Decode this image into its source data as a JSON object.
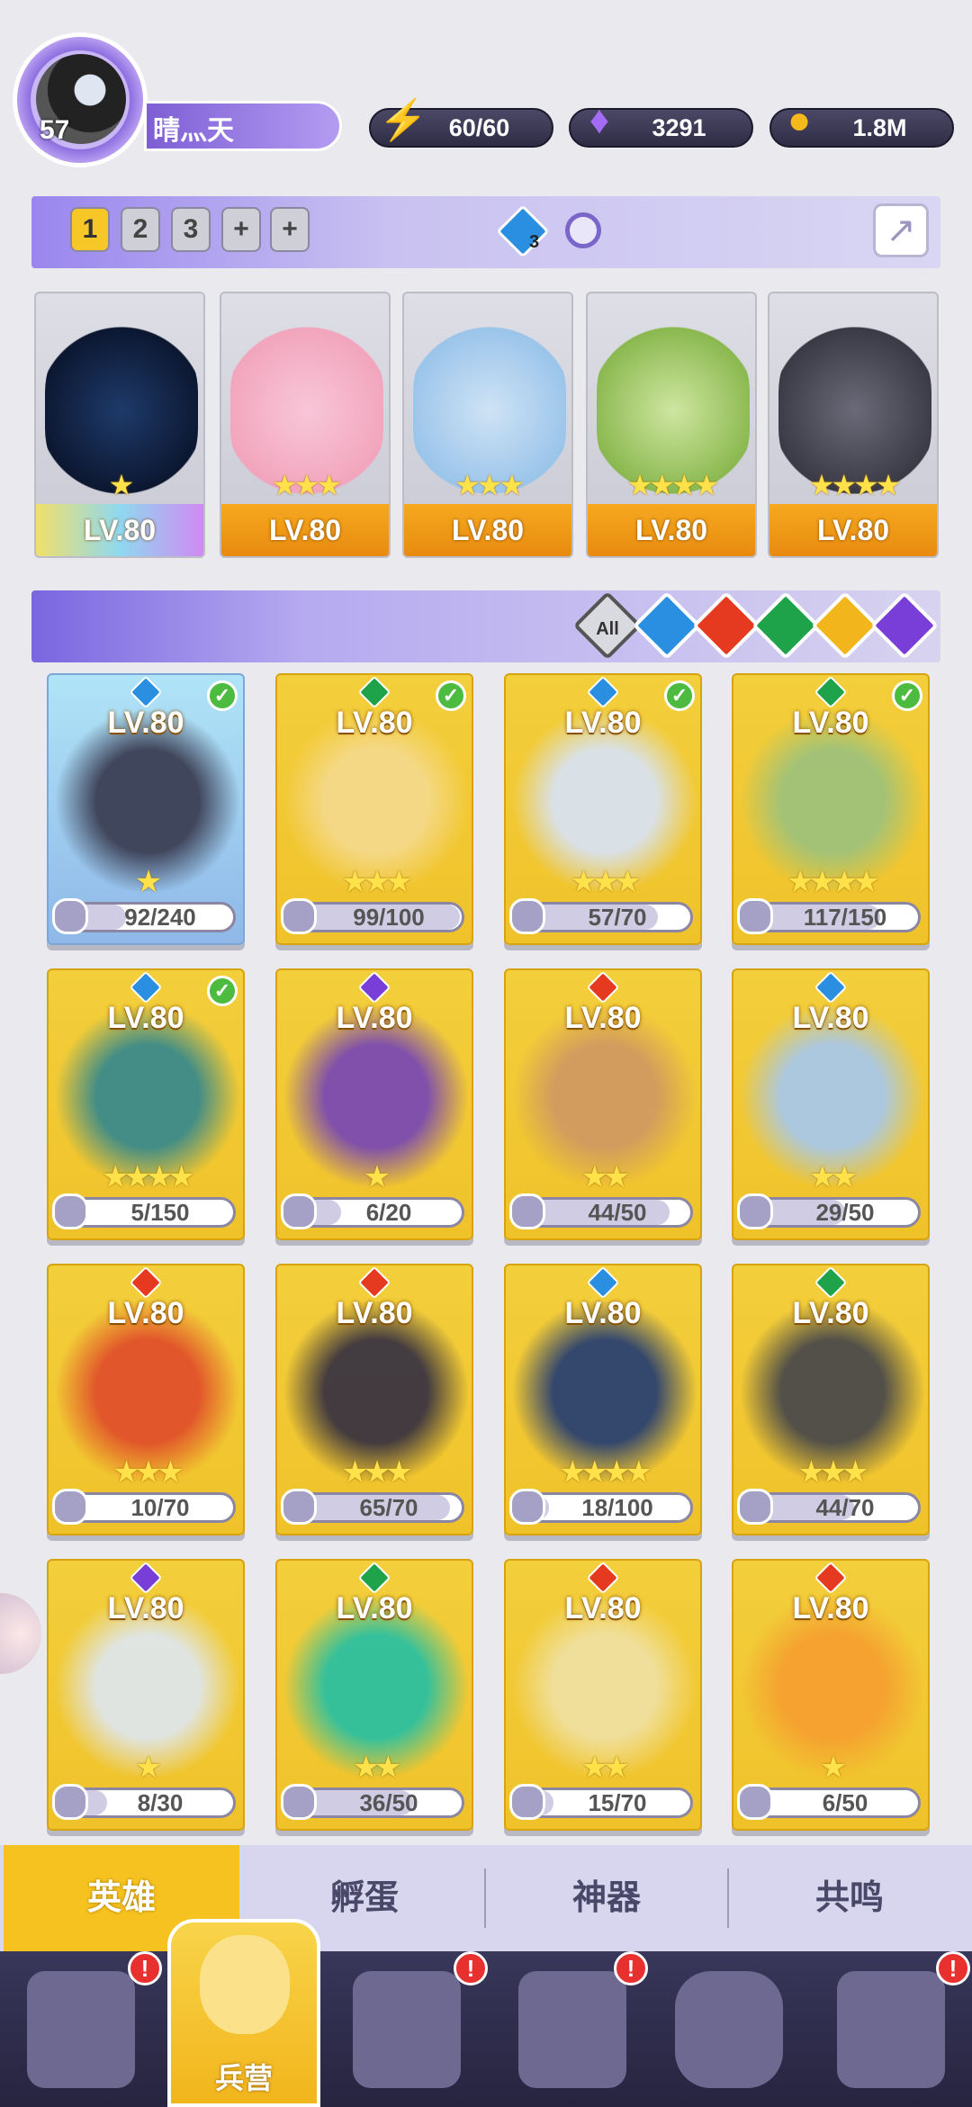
{
  "player": {
    "level": "57",
    "name": "晴灬天"
  },
  "resources": {
    "energy": "60/60",
    "gems": "3291",
    "gold": "1.8M"
  },
  "team_tabs": [
    "1",
    "2",
    "3",
    "+",
    "+"
  ],
  "team_badge_count": "3",
  "team": [
    {
      "level": "LV.80",
      "stars": "★",
      "element": "water",
      "frame": "rainbow"
    },
    {
      "level": "LV.80",
      "stars": "★★★",
      "element": "wind"
    },
    {
      "level": "LV.80",
      "stars": "★★★",
      "element": "water"
    },
    {
      "level": "LV.80",
      "stars": "★★★★",
      "element": "wind"
    },
    {
      "level": "LV.80",
      "stars": "★★★★",
      "element": "water"
    }
  ],
  "filters": {
    "all_label": "All",
    "elements": [
      "water",
      "fire",
      "wind",
      "light",
      "dark"
    ]
  },
  "heroes": [
    {
      "level": "LV.80",
      "element": "water",
      "checked": true,
      "stars": "★",
      "progress": "92/240",
      "ratio": 0.38
    },
    {
      "level": "LV.80",
      "element": "wind",
      "checked": true,
      "stars": "★★★",
      "progress": "99/100",
      "ratio": 0.99
    },
    {
      "level": "LV.80",
      "element": "water",
      "checked": true,
      "stars": "★★★",
      "progress": "57/70",
      "ratio": 0.81
    },
    {
      "level": "LV.80",
      "element": "wind",
      "checked": true,
      "stars": "★★★★",
      "progress": "117/150",
      "ratio": 0.78
    },
    {
      "level": "LV.80",
      "element": "water",
      "checked": true,
      "stars": "★★★★",
      "progress": "5/150",
      "ratio": 0.03
    },
    {
      "level": "LV.80",
      "element": "dark",
      "checked": false,
      "stars": "★",
      "progress": "6/20",
      "ratio": 0.3
    },
    {
      "level": "LV.80",
      "element": "fire",
      "checked": false,
      "stars": "★★",
      "progress": "44/50",
      "ratio": 0.88
    },
    {
      "level": "LV.80",
      "element": "water",
      "checked": false,
      "stars": "★★",
      "progress": "29/50",
      "ratio": 0.58
    },
    {
      "level": "LV.80",
      "element": "fire",
      "checked": false,
      "stars": "★★★",
      "progress": "10/70",
      "ratio": 0.14
    },
    {
      "level": "LV.80",
      "element": "fire",
      "checked": false,
      "stars": "★★★",
      "progress": "65/70",
      "ratio": 0.93
    },
    {
      "level": "LV.80",
      "element": "water",
      "checked": false,
      "stars": "★★★★",
      "progress": "18/100",
      "ratio": 0.18
    },
    {
      "level": "LV.80",
      "element": "wind",
      "checked": false,
      "stars": "★★★",
      "progress": "44/70",
      "ratio": 0.63
    },
    {
      "level": "LV.80",
      "element": "dark",
      "checked": false,
      "stars": "★",
      "progress": "8/30",
      "ratio": 0.27
    },
    {
      "level": "LV.80",
      "element": "wind",
      "checked": false,
      "stars": "★★",
      "progress": "36/50",
      "ratio": 0.72
    },
    {
      "level": "LV.80",
      "element": "fire",
      "checked": false,
      "stars": "★★",
      "progress": "15/70",
      "ratio": 0.21
    },
    {
      "level": "LV.80",
      "element": "fire",
      "checked": false,
      "stars": "★",
      "progress": "6/50",
      "ratio": 0.12
    }
  ],
  "sub_tabs": [
    "英雄",
    "孵蛋",
    "神器",
    "共鸣"
  ],
  "nav": {
    "active_label": "兵营",
    "badge": "!"
  },
  "colors": {
    "water": "#2a8fe0",
    "fire": "#e53a1f",
    "wind": "#1fa34a",
    "light": "#f2b51c",
    "dark": "#7a3ed8",
    "accent": "#f6c21f"
  }
}
